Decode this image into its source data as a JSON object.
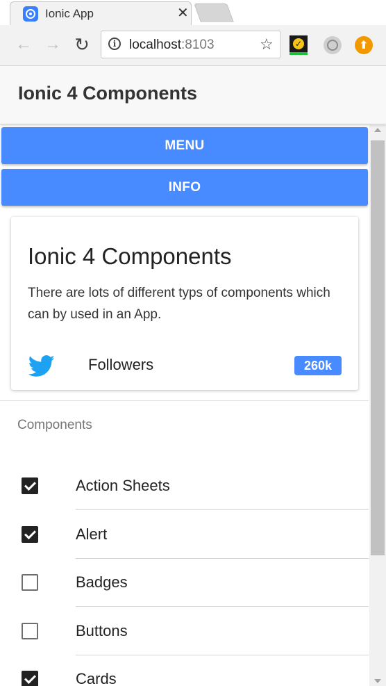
{
  "browser": {
    "tab_title": "Ionic App",
    "tab_close": "✕",
    "url_host": "localhost",
    "url_port": ":8103",
    "info_icon": "i",
    "star_icon": "☆",
    "back_icon": "←",
    "forward_icon": "→",
    "reload_icon": "↻",
    "extensions": [
      "checkmark-extension-icon",
      "circle-extension-icon",
      "upload-extension-icon"
    ],
    "upload_glyph": "⬆"
  },
  "header": {
    "title": "Ionic 4 Components"
  },
  "buttons": {
    "menu_label": "MENU",
    "info_label": "INFO",
    "color": "#488aff"
  },
  "card": {
    "title": "Ionic 4 Components",
    "text": "There are lots of different typs of components which can by used in an App.",
    "followers_label": "Followers",
    "followers_count": "260k",
    "icon": "twitter-icon"
  },
  "list": {
    "header": "Components",
    "items": [
      {
        "label": "Action Sheets",
        "checked": true
      },
      {
        "label": "Alert",
        "checked": true
      },
      {
        "label": "Badges",
        "checked": false
      },
      {
        "label": "Buttons",
        "checked": false
      },
      {
        "label": "Cards",
        "checked": true
      }
    ]
  },
  "colors": {
    "accent": "#488aff",
    "twitter": "#1da1f2"
  }
}
